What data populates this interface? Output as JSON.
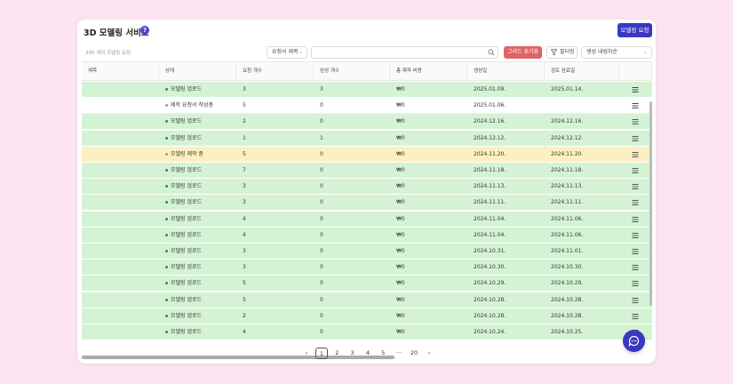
{
  "header": {
    "title": "3D 모델링 서비스",
    "help": "?",
    "request_button": "모델링 요청"
  },
  "toolbar": {
    "count_text": "395 개의 모델링 요청",
    "column_select": "요청서 제목",
    "search_placeholder": "",
    "reset_button": "그리드 초기화",
    "filter_button": "필터링",
    "sort_select": "생성 내림차순"
  },
  "columns": [
    "제목",
    "상태",
    "요청 개수",
    "완성 개수",
    "총 제작 비용",
    "생성일",
    "검토 완료일"
  ],
  "rows": [
    {
      "title": "",
      "status": "모델링 업로드",
      "req": "3",
      "done": "3",
      "cost": "₩0",
      "created": "2025.01.09.",
      "reviewed": "2025.01.14.",
      "tone": "green"
    },
    {
      "title": "",
      "status": "제작 요청서 작성중",
      "req": "5",
      "done": "0",
      "cost": "₩0",
      "created": "2025.01.06.",
      "reviewed": "",
      "tone": "white"
    },
    {
      "title": "",
      "status": "모델링 업로드",
      "req": "2",
      "done": "0",
      "cost": "₩0",
      "created": "2024.12.16.",
      "reviewed": "2024.12.16.",
      "tone": "green"
    },
    {
      "title": "",
      "status": "모델링 업로드",
      "req": "1",
      "done": "1",
      "cost": "₩0",
      "created": "2024.12.12.",
      "reviewed": "2024.12.12.",
      "tone": "green"
    },
    {
      "title": "",
      "status": "모델링 제작 중",
      "req": "5",
      "done": "0",
      "cost": "₩0",
      "created": "2024.11.20.",
      "reviewed": "2024.11.20.",
      "tone": "yellow"
    },
    {
      "title": "",
      "status": "모델링 업로드",
      "req": "7",
      "done": "0",
      "cost": "₩0",
      "created": "2024.11.18.",
      "reviewed": "2024.11.18.",
      "tone": "green"
    },
    {
      "title": "",
      "status": "모델링 업로드",
      "req": "3",
      "done": "0",
      "cost": "₩0",
      "created": "2024.11.13.",
      "reviewed": "2024.11.13.",
      "tone": "green"
    },
    {
      "title": "",
      "status": "모델링 업로드",
      "req": "3",
      "done": "0",
      "cost": "₩0",
      "created": "2024.11.11.",
      "reviewed": "2024.11.11.",
      "tone": "green"
    },
    {
      "title": "",
      "status": "모델링 업로드",
      "req": "4",
      "done": "0",
      "cost": "₩0",
      "created": "2024.11.04.",
      "reviewed": "2024.11.06.",
      "tone": "green"
    },
    {
      "title": "",
      "status": "모델링 업로드",
      "req": "4",
      "done": "0",
      "cost": "₩0",
      "created": "2024.11.04.",
      "reviewed": "2024.11.06.",
      "tone": "green"
    },
    {
      "title": "",
      "status": "모델링 업로드",
      "req": "3",
      "done": "0",
      "cost": "₩0",
      "created": "2024.10.31.",
      "reviewed": "2024.11.01.",
      "tone": "green"
    },
    {
      "title": "",
      "status": "모델링 업로드",
      "req": "3",
      "done": "0",
      "cost": "₩0",
      "created": "2024.10.30.",
      "reviewed": "2024.10.30.",
      "tone": "green"
    },
    {
      "title": "",
      "status": "모델링 업로드",
      "req": "5",
      "done": "0",
      "cost": "₩0",
      "created": "2024.10.29.",
      "reviewed": "2024.10.29.",
      "tone": "green"
    },
    {
      "title": "",
      "status": "모델링 업로드",
      "req": "5",
      "done": "0",
      "cost": "₩0",
      "created": "2024.10.28.",
      "reviewed": "2024.10.28.",
      "tone": "green"
    },
    {
      "title": "",
      "status": "모델링 업로드",
      "req": "2",
      "done": "0",
      "cost": "₩0",
      "created": "2024.10.28.",
      "reviewed": "2024.10.28.",
      "tone": "green"
    },
    {
      "title": "",
      "status": "모델링 업로드",
      "req": "4",
      "done": "0",
      "cost": "₩0",
      "created": "2024.10.24.",
      "reviewed": "2024.10.25.",
      "tone": "green"
    }
  ],
  "pagination": {
    "prev": "‹",
    "pages": [
      "1",
      "2",
      "3",
      "4",
      "5"
    ],
    "ellipsis": "···",
    "last": "20",
    "next": "›",
    "current": "1"
  },
  "colors": {
    "accent": "#3a38c1",
    "green_row": "#d4f3d4",
    "yellow_row": "#fdf0c0",
    "reset": "#e06464"
  }
}
